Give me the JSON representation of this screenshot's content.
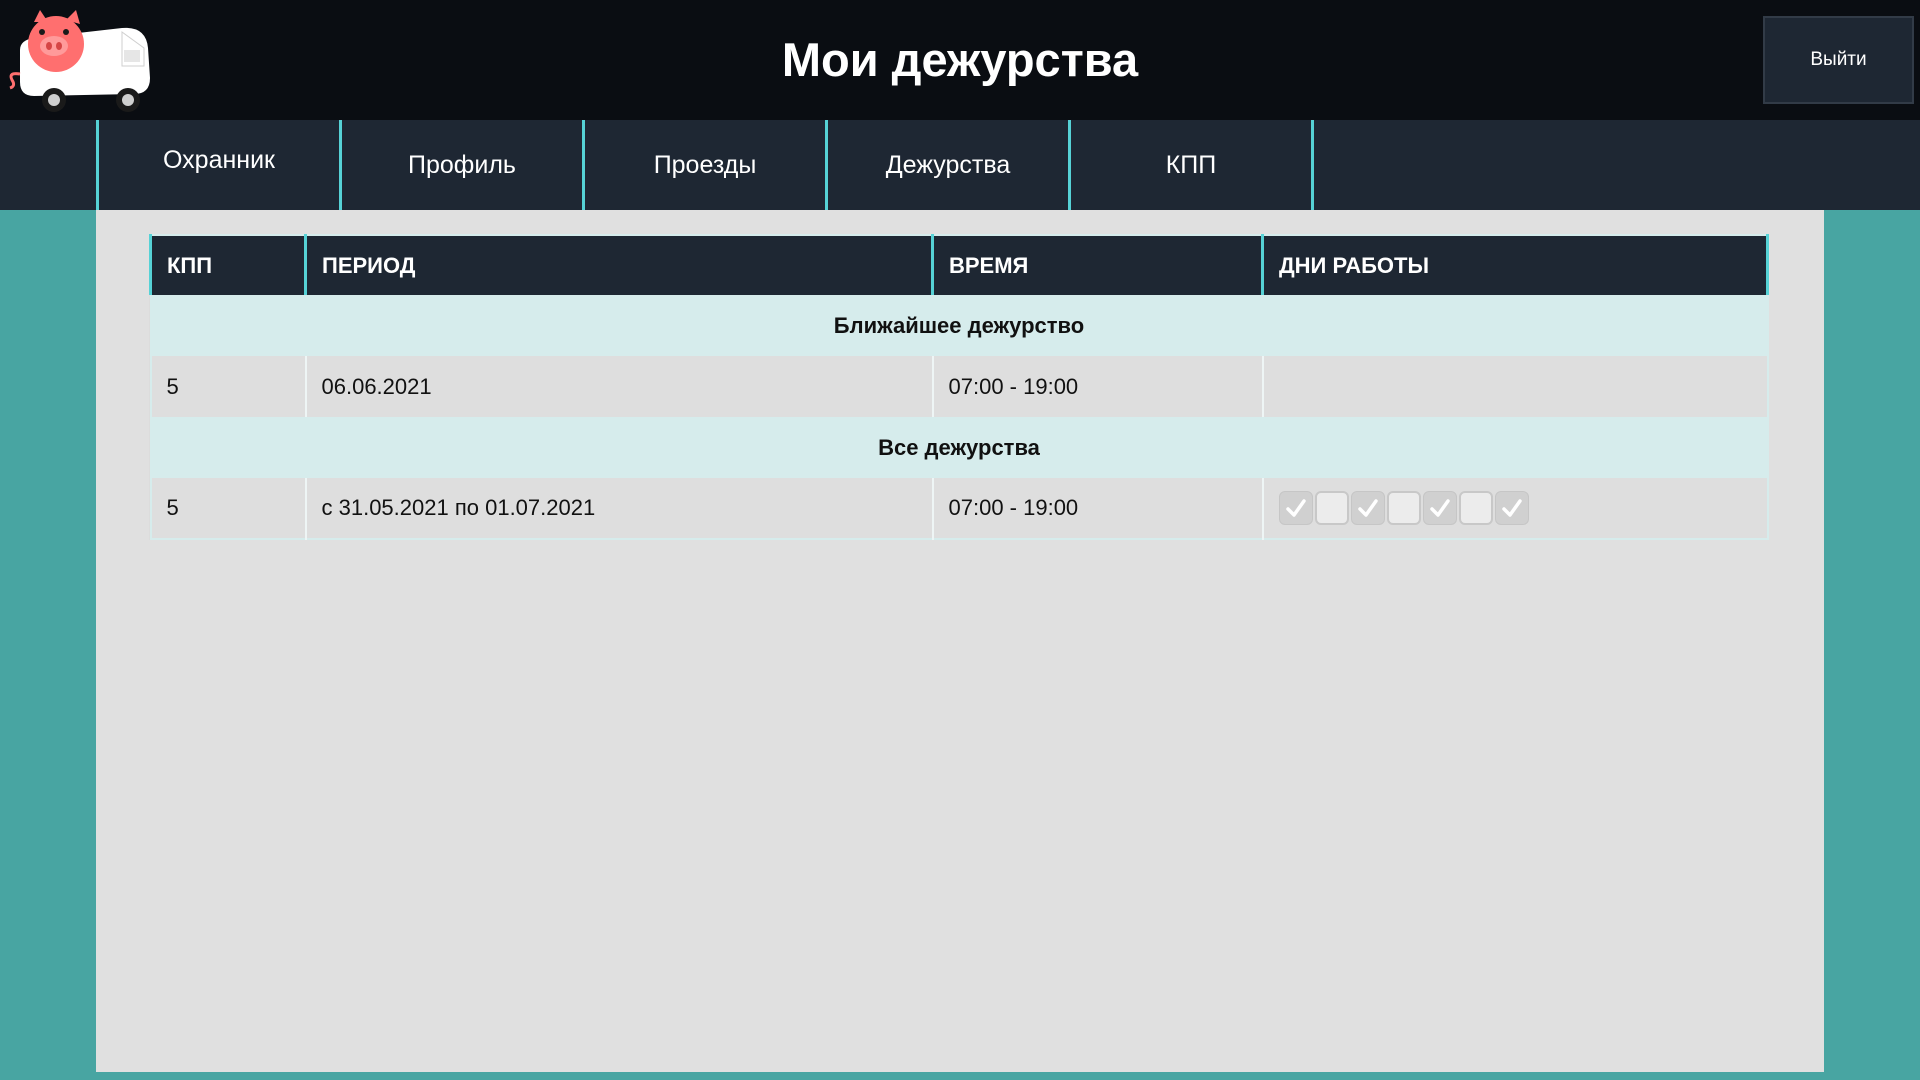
{
  "header": {
    "title": "Мои дежурства",
    "logout_label": "Выйти"
  },
  "nav": {
    "tabs": [
      {
        "label": "Охранник"
      },
      {
        "label": "Профиль"
      },
      {
        "label": "Проезды"
      },
      {
        "label": "Дежурства"
      },
      {
        "label": "КПП"
      }
    ]
  },
  "table": {
    "columns": [
      "КПП",
      "ПЕРИОД",
      "ВРЕМЯ",
      "ДНИ РАБОТЫ"
    ],
    "sections": [
      {
        "title": "Ближайшее дежурство",
        "rows": [
          {
            "kpp": "5",
            "period": "06.06.2021",
            "time": "07:00 - 19:00"
          }
        ]
      },
      {
        "title": "Все дежурства",
        "rows": [
          {
            "kpp": "5",
            "period": "с 31.05.2021 по 01.07.2021",
            "time": "07:00 - 19:00",
            "days": [
              true,
              false,
              true,
              false,
              true,
              false,
              true
            ]
          }
        ]
      }
    ]
  },
  "colors": {
    "background_accent": "#48a5a2",
    "header_bg": "#0a0d12",
    "nav_bg": "#1e2733",
    "tab_border": "#56d2d6",
    "section_bg": "#d6ecec"
  },
  "icons": {
    "logo": "pig-truck-logo",
    "day_checked": "checkmark-icon"
  }
}
